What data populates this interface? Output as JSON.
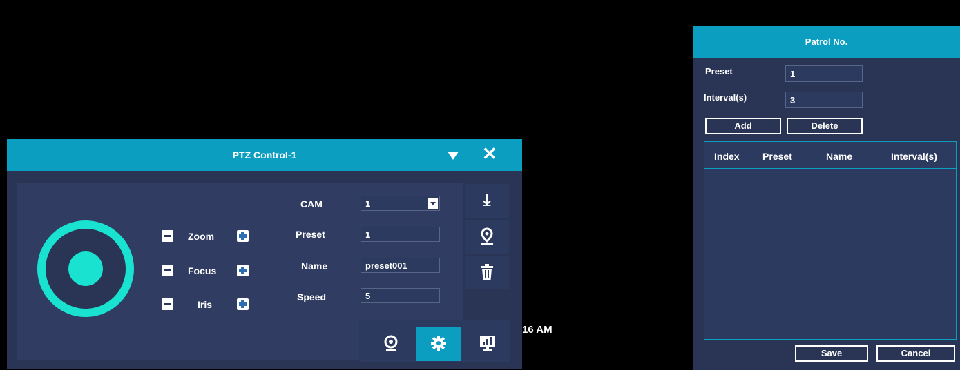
{
  "background_text": "16 AM",
  "ptz": {
    "title": "PTZ Control-1",
    "zoom_label": "Zoom",
    "focus_label": "Focus",
    "iris_label": "Iris",
    "cam_label": "CAM",
    "cam_value": "1",
    "preset_label": "Preset",
    "preset_value": "1",
    "name_label": "Name",
    "name_value": "preset001",
    "speed_label": "Speed",
    "speed_value": "5"
  },
  "patrol": {
    "title": "Patrol  No.",
    "preset_label": "Preset",
    "preset_value": "1",
    "interval_label": "Interval(s)",
    "interval_value": "3",
    "add_label": "Add",
    "delete_label": "Delete",
    "columns": [
      "Index",
      "Preset",
      "Name",
      "Interval(s)"
    ],
    "save_label": "Save",
    "cancel_label": "Cancel"
  },
  "colors": {
    "accent": "#0b9ec0",
    "panel": "#2a3556",
    "joystick": "#19e3d0"
  }
}
